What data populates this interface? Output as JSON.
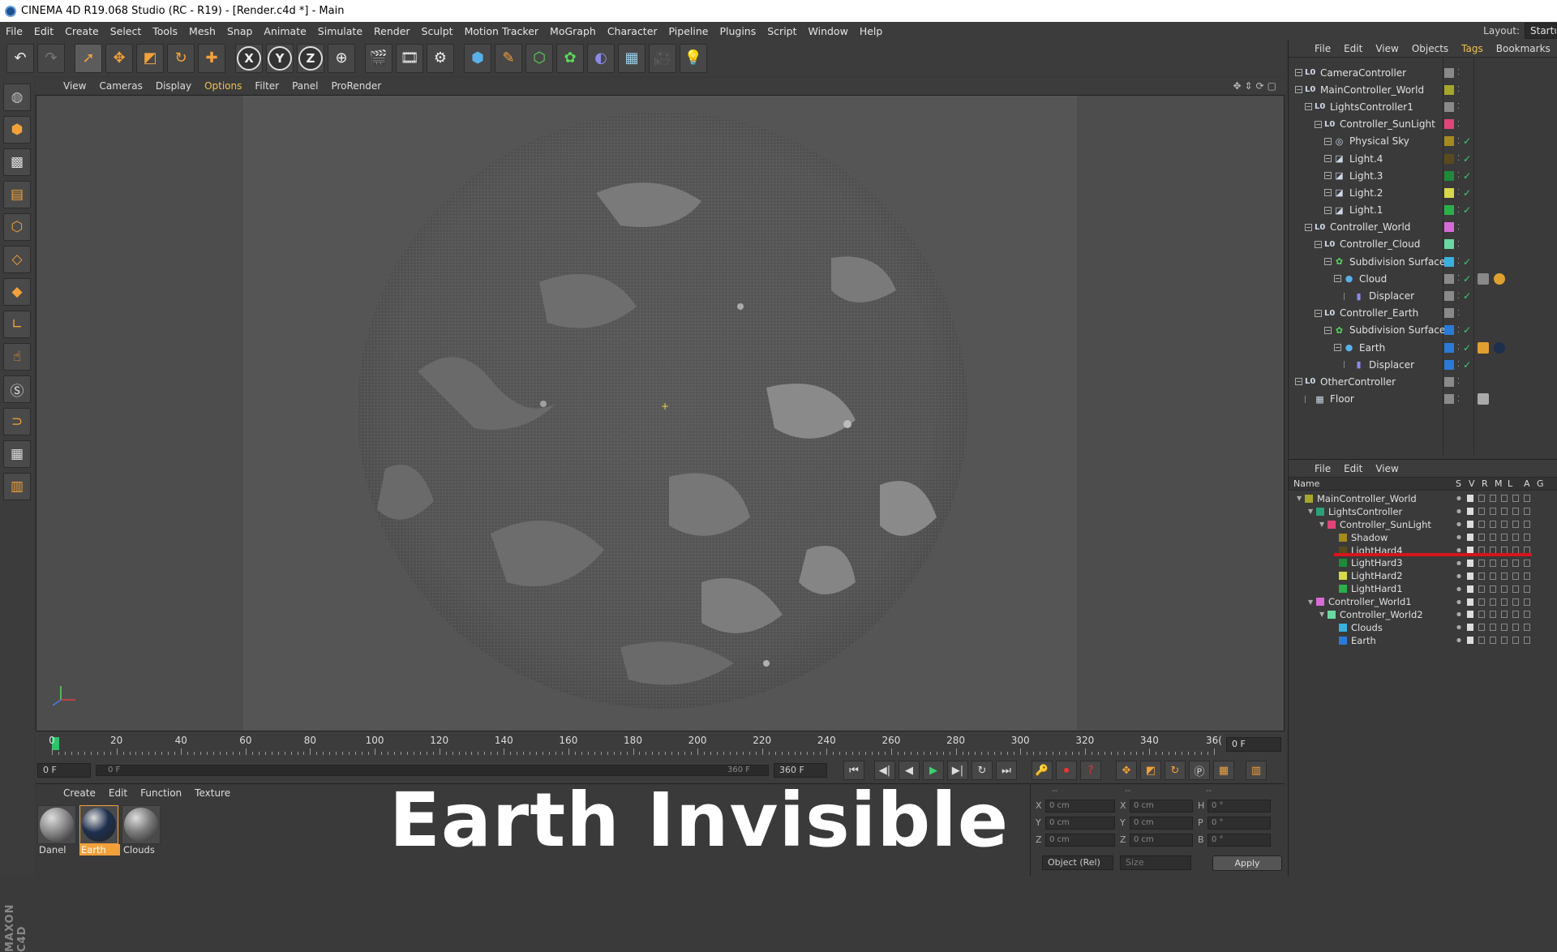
{
  "window": {
    "title": "CINEMA 4D R19.068 Studio (RC - R19) - [Render.c4d *] - Main"
  },
  "menubar": {
    "items": [
      "File",
      "Edit",
      "Create",
      "Select",
      "Tools",
      "Mesh",
      "Snap",
      "Animate",
      "Simulate",
      "Render",
      "Sculpt",
      "Motion Tracker",
      "MoGraph",
      "Character",
      "Pipeline",
      "Plugins",
      "Script",
      "Window",
      "Help"
    ],
    "layout_label": "Layout:",
    "layout_value": "Startu"
  },
  "toolbar": {
    "axis_x": "X",
    "axis_y": "Y",
    "axis_z": "Z"
  },
  "viewport": {
    "menu": [
      "View",
      "Cameras",
      "Display",
      "Options",
      "Filter",
      "Panel",
      "ProRender"
    ],
    "highlighted_menu": "Options"
  },
  "timeline": {
    "labels": [
      "0",
      "20",
      "40",
      "60",
      "80",
      "100",
      "120",
      "140",
      "160",
      "180",
      "200",
      "220",
      "240",
      "260",
      "280",
      "300",
      "320",
      "340",
      "36("
    ],
    "current_frame_field": "0 F"
  },
  "transport": {
    "start_field": "0 F",
    "slider_start": "0 F",
    "slider_end": "360 F",
    "end_field": "360 F"
  },
  "material_panel": {
    "menu": [
      "Create",
      "Edit",
      "Function",
      "Texture"
    ],
    "materials": [
      {
        "name": "Danel",
        "selected": false,
        "color": "#8a8a8a"
      },
      {
        "name": "Earth",
        "selected": true,
        "color": "#1e2f4d"
      },
      {
        "name": "Clouds",
        "selected": false,
        "color": "#7a7a7a"
      }
    ],
    "overlay_caption": "Earth Invisible"
  },
  "coordinates": {
    "header": [
      "--",
      "--",
      "--"
    ],
    "rows": [
      {
        "a": "X",
        "a_val": "0 cm",
        "b": "X",
        "b_val": "0 cm",
        "c": "H",
        "c_val": "0 °"
      },
      {
        "a": "Y",
        "a_val": "0 cm",
        "b": "Y",
        "b_val": "0 cm",
        "c": "P",
        "c_val": "0 °"
      },
      {
        "a": "Z",
        "a_val": "0 cm",
        "b": "Z",
        "b_val": "0 cm",
        "c": "B",
        "c_val": "0 °"
      }
    ],
    "mode_dropdown": "Object (Rel)",
    "size_dropdown": "Size",
    "apply_label": "Apply"
  },
  "object_manager": {
    "menu": [
      "File",
      "Edit",
      "View",
      "Objects",
      "Tags",
      "Bookmarks"
    ],
    "highlighted_menu": "Tags",
    "objects": [
      {
        "name": "CameraController",
        "depth": 0,
        "icon": "null-icon",
        "layer": "#8a8a8a",
        "check": false
      },
      {
        "name": "MainController_World",
        "depth": 0,
        "icon": "null-icon",
        "layer": "#a6a62a",
        "check": false
      },
      {
        "name": "LightsController1",
        "depth": 1,
        "icon": "null-icon",
        "layer": "#8a8a8a",
        "check": false
      },
      {
        "name": "Controller_SunLight",
        "depth": 2,
        "icon": "null-icon",
        "layer": "#e0457a",
        "check": false
      },
      {
        "name": "Physical Sky",
        "depth": 3,
        "icon": "sky-icon",
        "layer": "#a58a1e",
        "check": true
      },
      {
        "name": "Light.4",
        "depth": 3,
        "icon": "light-icon",
        "layer": "#5a4a1e",
        "check": true
      },
      {
        "name": "Light.3",
        "depth": 3,
        "icon": "light-icon",
        "layer": "#1e8a3a",
        "check": true
      },
      {
        "name": "Light.2",
        "depth": 3,
        "icon": "light-icon",
        "layer": "#d8d84a",
        "check": true
      },
      {
        "name": "Light.1",
        "depth": 3,
        "icon": "light-icon",
        "layer": "#2ab04a",
        "check": true
      },
      {
        "name": "Controller_World",
        "depth": 1,
        "icon": "null-icon",
        "layer": "#d86ad8",
        "check": false
      },
      {
        "name": "Controller_Cloud",
        "depth": 2,
        "icon": "null-icon",
        "layer": "#6ad8a0",
        "check": false
      },
      {
        "name": "Subdivision Surface",
        "depth": 3,
        "icon": "subdivision-icon",
        "layer": "#3ab0e0",
        "check": true
      },
      {
        "name": "Cloud",
        "depth": 4,
        "icon": "sphere-icon",
        "layer": "#8a8a8a",
        "check": true,
        "tags": [
          "#888888",
          "#e0a030"
        ]
      },
      {
        "name": "Displacer",
        "depth": 5,
        "icon": "deformer-icon",
        "layer": "#8a8a8a",
        "check": true
      },
      {
        "name": "Controller_Earth",
        "depth": 2,
        "icon": "null-icon",
        "layer": "#8a8a8a",
        "check": false
      },
      {
        "name": "Subdivision Surface",
        "depth": 3,
        "icon": "subdivision-icon",
        "layer": "#2a7ad8",
        "check": true
      },
      {
        "name": "Earth",
        "depth": 4,
        "icon": "sphere-icon",
        "layer": "#2a7ad8",
        "check": true,
        "tags": [
          "#e0a030",
          "#1e2f4d"
        ]
      },
      {
        "name": "Displacer",
        "depth": 5,
        "icon": "deformer-icon",
        "layer": "#2a7ad8",
        "check": true
      },
      {
        "name": "OtherController",
        "depth": 0,
        "icon": "null-icon",
        "layer": "#8a8a8a",
        "check": false
      },
      {
        "name": "Floor",
        "depth": 1,
        "icon": "floor-icon",
        "layer": "#8a8a8a",
        "check": false,
        "tags": [
          "#aaaaaa"
        ]
      }
    ]
  },
  "layer_manager": {
    "menu": [
      "File",
      "Edit",
      "View"
    ],
    "columns": [
      "Name",
      "S",
      "V",
      "R",
      "M",
      "L",
      "A",
      "G"
    ],
    "layers": [
      {
        "name": "MainController_World",
        "depth": 0,
        "color": "#a6a62a",
        "open": true
      },
      {
        "name": "LightsController",
        "depth": 1,
        "color": "#2aa07a",
        "open": true
      },
      {
        "name": "Controller_SunLight",
        "depth": 2,
        "color": "#e0457a",
        "open": true
      },
      {
        "name": "Shadow",
        "depth": 3,
        "color": "#a58a1e",
        "open": false
      },
      {
        "name": "LightHard4",
        "depth": 3,
        "color": "#5a4a1e",
        "open": false
      },
      {
        "name": "LightHard3",
        "depth": 3,
        "color": "#1e8a3a",
        "open": false
      },
      {
        "name": "LightHard2",
        "depth": 3,
        "color": "#d8d84a",
        "open": false
      },
      {
        "name": "LightHard1",
        "depth": 3,
        "color": "#2ab04a",
        "open": false
      },
      {
        "name": "Controller_World1",
        "depth": 1,
        "color": "#d86ad8",
        "open": true
      },
      {
        "name": "Controller_World2",
        "depth": 2,
        "color": "#6ad8a0",
        "open": true
      },
      {
        "name": "Clouds",
        "depth": 3,
        "color": "#3ab0e0",
        "open": false
      },
      {
        "name": "Earth",
        "depth": 3,
        "color": "#2a7ad8",
        "open": false
      }
    ]
  }
}
